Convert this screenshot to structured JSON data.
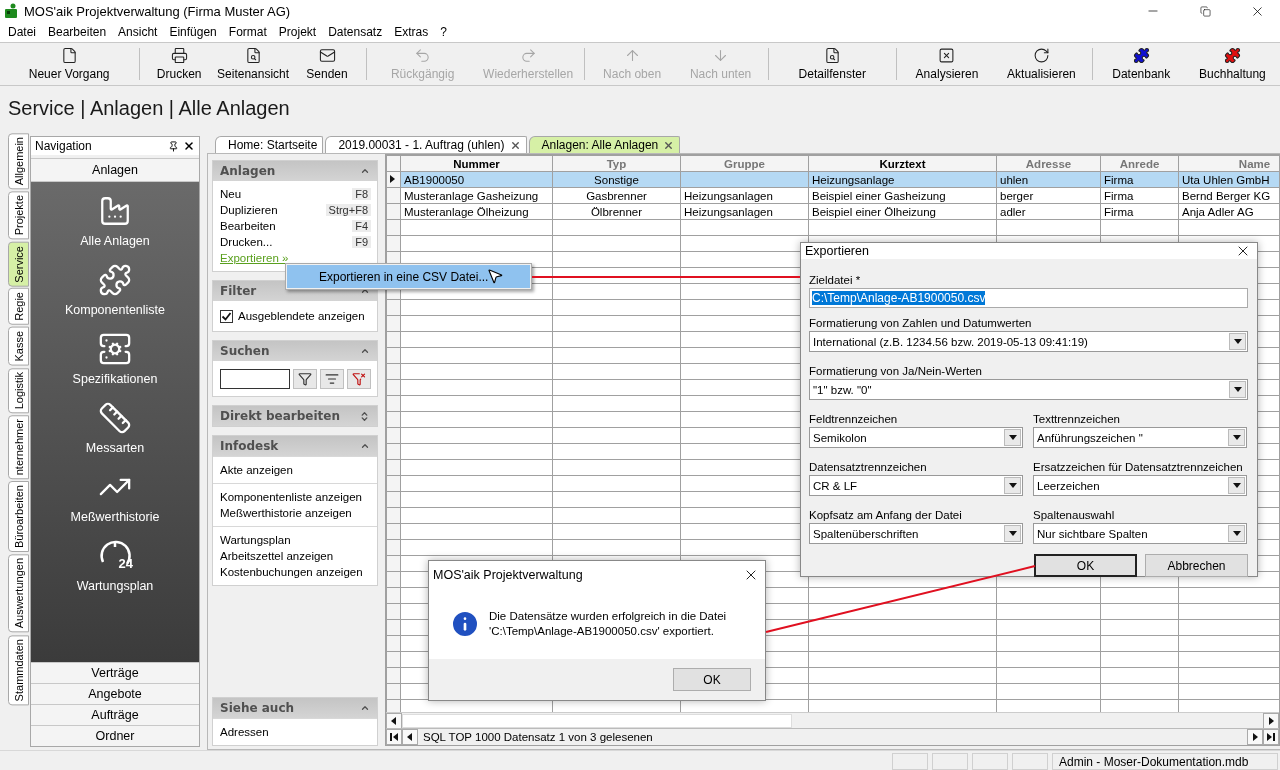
{
  "window": {
    "title": "MOS'aik Projektverwaltung (Firma Muster AG)"
  },
  "menu": [
    "Datei",
    "Bearbeiten",
    "Ansicht",
    "Einfügen",
    "Format",
    "Projekt",
    "Datensatz",
    "Extras",
    "?"
  ],
  "toolbar": {
    "groups": [
      [
        {
          "label": "Neuer Vorgang",
          "disabled": false
        }
      ],
      [
        {
          "label": "Drucken",
          "disabled": false
        },
        {
          "label": "Seitenansicht",
          "disabled": false
        },
        {
          "label": "Senden",
          "disabled": false
        }
      ],
      [
        {
          "label": "Rückgängig",
          "disabled": true
        },
        {
          "label": "Wiederherstellen",
          "disabled": true
        }
      ],
      [
        {
          "label": "Nach oben",
          "disabled": true
        },
        {
          "label": "Nach unten",
          "disabled": true
        }
      ],
      [
        {
          "label": "Detailfenster",
          "disabled": false
        }
      ],
      [
        {
          "label": "Analysieren",
          "disabled": false
        },
        {
          "label": "Aktualisieren",
          "disabled": false
        }
      ],
      [
        {
          "label": "Datenbank",
          "disabled": false
        },
        {
          "label": "Buchhaltung",
          "disabled": false
        }
      ]
    ]
  },
  "breadcrumb": "Service | Anlagen | Alle Anlagen",
  "side_tabs": [
    {
      "label": "Allgemein",
      "selected": false
    },
    {
      "label": "Projekte",
      "selected": false
    },
    {
      "label": "Service",
      "selected": true
    },
    {
      "label": "Regie",
      "selected": false
    },
    {
      "label": "Kasse",
      "selected": false
    },
    {
      "label": "Logistik",
      "selected": false
    },
    {
      "label": "nternehmer",
      "selected": false
    },
    {
      "label": "Büroarbeiten",
      "selected": false
    },
    {
      "label": "Auswertungen",
      "selected": false
    },
    {
      "label": "Stammdaten",
      "selected": false
    }
  ],
  "navigation": {
    "title": "Navigation",
    "group": "Anlagen",
    "items": [
      {
        "label": "Alle Anlagen"
      },
      {
        "label": "Komponentenliste"
      },
      {
        "label": "Spezifikationen"
      },
      {
        "label": "Messarten"
      },
      {
        "label": "Meßwerthistorie"
      },
      {
        "label": "Wartungsplan",
        "badge": "24"
      }
    ],
    "sections": [
      "Verträge",
      "Angebote",
      "Aufträge",
      "Ordner"
    ]
  },
  "doc_tabs": [
    {
      "label": "Home: Startseite",
      "selected": false,
      "closable": false
    },
    {
      "label": "2019.00031 - 1. Auftrag (uhlen)",
      "selected": false,
      "closable": true
    },
    {
      "label": "Anlagen: Alle Anlagen",
      "selected": true,
      "closable": true
    }
  ],
  "task_panel": {
    "sections": [
      {
        "title": "Anlagen",
        "expanded": true,
        "kind": "actions",
        "items": [
          {
            "label": "Neu",
            "shortcut": "F8",
            "kind": "action"
          },
          {
            "label": "Duplizieren",
            "shortcut": "Strg+F8",
            "kind": "action"
          },
          {
            "label": "Bearbeiten",
            "shortcut": "F4",
            "kind": "action"
          },
          {
            "label": "Drucken...",
            "shortcut": "F9",
            "kind": "action"
          },
          {
            "label": "Exportieren »",
            "kind": "link"
          }
        ]
      },
      {
        "title": "Filter",
        "expanded": true,
        "kind": "checkbox",
        "items": [
          {
            "label": "Ausgeblendete anzeigen",
            "checked": true
          }
        ]
      },
      {
        "title": "Suchen",
        "expanded": true,
        "kind": "search"
      },
      {
        "title": "Direkt bearbeiten",
        "expanded": false
      },
      {
        "title": "Infodesk",
        "expanded": true,
        "kind": "links",
        "groups": [
          [
            "Akte anzeigen"
          ],
          [
            "Komponentenliste anzeigen",
            "Meßwerthistorie anzeigen"
          ],
          [
            "Wartungsplan",
            "Arbeitszettel anzeigen",
            "Kostenbuchungen anzeigen"
          ]
        ]
      },
      {
        "title": "Siehe auch",
        "expanded": true,
        "kind": "links",
        "groups": [
          [
            "Adressen"
          ]
        ]
      }
    ]
  },
  "grid": {
    "columns": [
      {
        "label": "Nummer",
        "emphasized": true
      },
      {
        "label": "Typ",
        "emphasized": false
      },
      {
        "label": "Gruppe",
        "emphasized": false
      },
      {
        "label": "Kurztext",
        "emphasized": true
      },
      {
        "label": "Adresse",
        "emphasized": false
      },
      {
        "label": "Anrede",
        "emphasized": false
      },
      {
        "label": "Name",
        "emphasized": false
      }
    ],
    "rows": [
      {
        "selected": true,
        "cells": [
          "AB1900050",
          "Sonstige",
          "",
          "Heizungsanlage",
          "uhlen",
          "Firma",
          "Uta Uhlen GmbH"
        ]
      },
      {
        "selected": false,
        "cells": [
          "Musteranlage Gasheizung",
          "Gasbrenner",
          "Heizungsanlagen",
          "Beispiel einer Gasheizung",
          "berger",
          "Firma",
          "Bernd Berger KG"
        ]
      },
      {
        "selected": false,
        "cells": [
          "Musteranlage Ölheizung",
          "Ölbrenner",
          "Heizungsanlagen",
          "Beispiel einer Ölheizung",
          "adler",
          "Firma",
          "Anja Adler AG"
        ]
      }
    ],
    "record_info": "SQL TOP 1000 Datensatz 1 von 3 gelesenen"
  },
  "context_menu": {
    "items": [
      {
        "label": "Exportieren in eine CSV Datei...",
        "selected": true
      }
    ]
  },
  "export_dialog": {
    "title": "Exportieren",
    "target_label": "Zieldatei *",
    "target_value": "C:\\Temp\\Anlage-AB1900050.csv",
    "full_fields": [
      {
        "label": "Formatierung von Zahlen und Datumwerten",
        "value": "International (z.B. 1234.56 bzw. 2019-05-13 09:41:19)"
      },
      {
        "label": "Formatierung von Ja/Nein-Werten",
        "value": "\"1\" bzw. \"0\""
      }
    ],
    "field_pairs": [
      [
        {
          "label": "Feldtrennzeichen",
          "value": "Semikolon"
        },
        {
          "label": "Texttrennzeichen",
          "value": "Anführungszeichen \""
        }
      ],
      [
        {
          "label": "Datensatztrennzeichen",
          "value": "CR & LF"
        },
        {
          "label": "Ersatzzeichen für Datensatztrennzeichen",
          "value": "Leerzeichen"
        }
      ],
      [
        {
          "label": "Kopfsatz am Anfang der Datei",
          "value": "Spaltenüberschriften"
        },
        {
          "label": "Spaltenauswahl",
          "value": "Nur sichtbare Spalten"
        }
      ]
    ],
    "buttons": [
      {
        "label": "OK",
        "default": true
      },
      {
        "label": "Abbrechen",
        "default": false
      }
    ]
  },
  "message_box": {
    "title": "MOS'aik Projektverwaltung",
    "message": "Die Datensätze wurden erfolgreich in die Datei\n'C:\\Temp\\Anlage-AB1900050.csv' exportiert.",
    "button": "OK"
  },
  "status_bar": {
    "text": "Admin - Moser-Dokumentation.mdb"
  }
}
